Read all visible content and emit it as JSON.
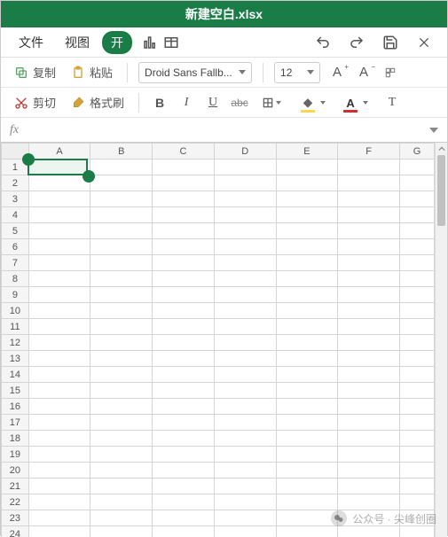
{
  "titlebar": {
    "title": "新建空白.xlsx"
  },
  "menu": {
    "file": "文件",
    "view": "视图",
    "start": "开"
  },
  "toolbar1": {
    "copy": "复制",
    "paste": "粘贴",
    "cut": "剪切",
    "format_painter": "格式刷",
    "font_name": "Droid Sans Fallb...",
    "font_size": "12",
    "a_plus": "A",
    "a_minus": "A"
  },
  "toolbar2": {
    "bold": "B",
    "italic": "I",
    "underline": "U",
    "strike": "abc",
    "text_label": "T"
  },
  "fx": {
    "label": "fx"
  },
  "grid": {
    "columns": [
      "A",
      "B",
      "C",
      "D",
      "E",
      "F",
      "G"
    ],
    "row_count": 24,
    "selected_cell": "A1"
  },
  "watermark": {
    "text": "公众号 · 尖峰创圈"
  },
  "colors": {
    "accent": "#1a7d47",
    "highlight": "#ffd54f",
    "font_color": "#d32f2f"
  }
}
